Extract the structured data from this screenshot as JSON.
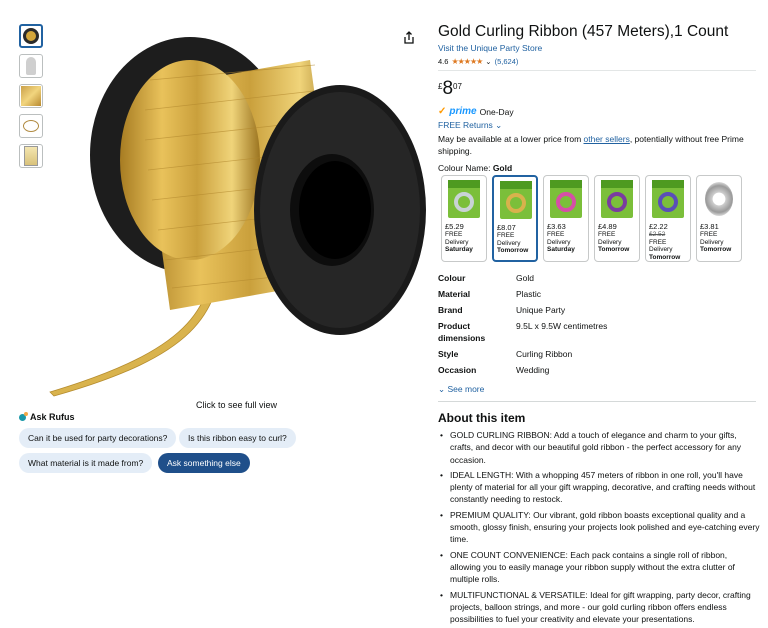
{
  "product": {
    "title": "Gold Curling Ribbon (457 Meters),1 Count",
    "store": "Visit the Unique Party Store",
    "rating": "4.6",
    "stars": "★★★★★",
    "rating_count": "(5,624)",
    "price_currency": "£",
    "price_whole": "8",
    "price_fraction": "07",
    "prime_label": "prime",
    "prime_delivery": "One-Day",
    "returns": "FREE Returns",
    "availability_prefix": "May be available at a lower price from ",
    "availability_link": "other sellers",
    "availability_suffix": ", potentially without free Prime shipping.",
    "colour_label": "Colour Name: ",
    "colour_value": "Gold"
  },
  "image": {
    "view_full": "Click to see full view"
  },
  "rufus": {
    "title": "Ask Rufus",
    "chips": [
      "Can it be used for party decorations?",
      "Is this ribbon easy to curl?",
      "What material is it made from?",
      "Ask something else"
    ]
  },
  "swatches": [
    {
      "price": "£5.29",
      "strike": "",
      "delivery": "FREE Delivery",
      "day": "Saturday",
      "roll_color": "#c9d3d6"
    },
    {
      "price": "£8.07",
      "strike": "",
      "delivery": "FREE Delivery",
      "day": "Tomorrow",
      "roll_color": "#d8b24c"
    },
    {
      "price": "£3.63",
      "strike": "",
      "delivery": "FREE Delivery",
      "day": "Saturday",
      "roll_color": "#d64fa7"
    },
    {
      "price": "£4.89",
      "strike": "",
      "delivery": "FREE Delivery",
      "day": "Tomorrow",
      "roll_color": "#7a3ca0"
    },
    {
      "price": "£2.22",
      "strike": "£2.52",
      "delivery": "FREE Delivery",
      "day": "Tomorrow",
      "roll_color": "#5a4fb8"
    },
    {
      "price": "£3.81",
      "strike": "",
      "delivery": "FREE Delivery",
      "day": "Tomorrow",
      "roll_color": "#b5b5b5"
    }
  ],
  "details": [
    {
      "label": "Colour",
      "value": "Gold"
    },
    {
      "label": "Material",
      "value": "Plastic"
    },
    {
      "label": "Brand",
      "value": "Unique Party"
    },
    {
      "label": "Product dimensions",
      "value": "9.5L x 9.5W centimetres"
    },
    {
      "label": "Style",
      "value": "Curling Ribbon"
    },
    {
      "label": "Occasion",
      "value": "Wedding"
    }
  ],
  "see_more": "See more",
  "about": {
    "title": "About this item",
    "bullets": [
      "GOLD CURLING RIBBON: Add a touch of elegance and charm to your gifts, crafts, and decor with our beautiful gold ribbon - the perfect accessory for any occasion.",
      "IDEAL LENGTH: With a whopping 457 meters of ribbon in one roll, you'll have plenty of material for all your gift wrapping, decorative, and crafting needs without constantly needing to restock.",
      "PREMIUM QUALITY: Our vibrant, gold ribbon boasts exceptional quality and a smooth, glossy finish, ensuring your projects look polished and eye-catching every time.",
      "ONE COUNT CONVENIENCE: Each pack contains a single roll of ribbon, allowing you to easily manage your ribbon supply without the extra clutter of multiple rolls.",
      "MULTIFUNCTIONAL & VERSATILE: Ideal for gift wrapping, party decor, crafting projects, balloon strings, and more - our gold curling ribbon offers endless possibilities to fuel your creativity and elevate your presentations."
    ]
  }
}
